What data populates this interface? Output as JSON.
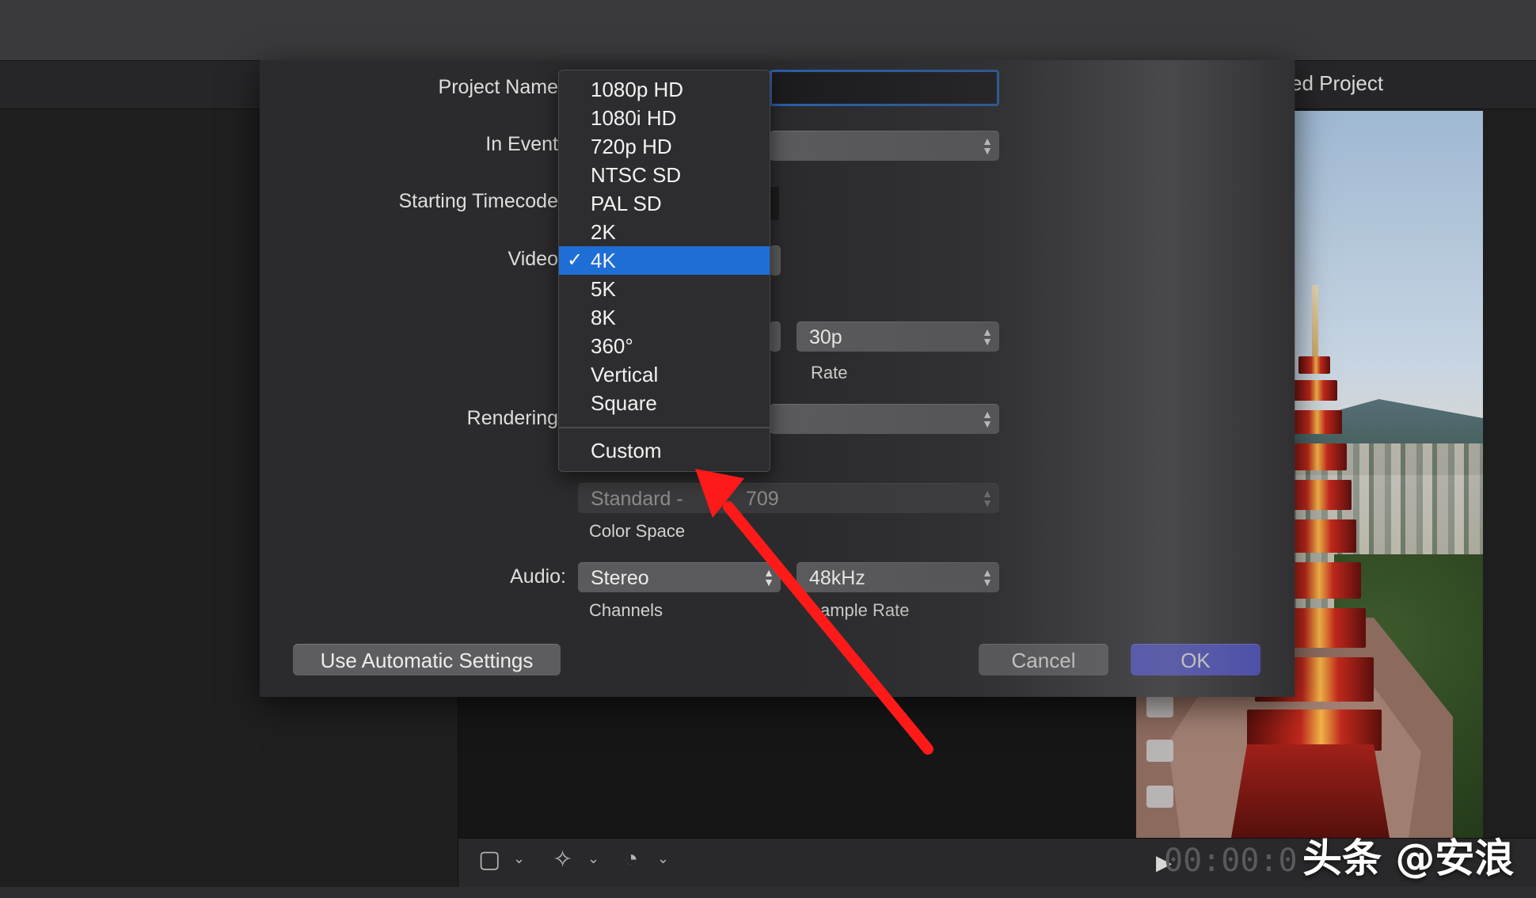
{
  "background": {
    "project_title_partial": "ed Project"
  },
  "dialog": {
    "labels": {
      "project_name": "Project Name",
      "in_event": "In Event",
      "starting_timecode": "Starting Timecode",
      "video": "Video",
      "rendering": "Rendering",
      "audio": "Audio:"
    },
    "frame_rate": {
      "value": "30p",
      "caption": "Rate"
    },
    "color_space": {
      "value": "Standard - Rec. 709",
      "value_visible": "Standard -",
      "value_tail": "709",
      "caption": "Color Space"
    },
    "audio": {
      "channels_value": "Stereo",
      "channels_caption": "Channels",
      "sample_rate_value": "48kHz",
      "sample_rate_caption_visible": "ample Rate"
    },
    "buttons": {
      "automatic": "Use Automatic Settings",
      "cancel": "Cancel",
      "ok": "OK"
    }
  },
  "format_menu": {
    "items": [
      "1080p HD",
      "1080i HD",
      "720p HD",
      "NTSC SD",
      "PAL SD",
      "2K",
      "4K",
      "5K",
      "8K",
      "360°",
      "Vertical",
      "Square"
    ],
    "selected": "4K",
    "check_glyph": "✓",
    "custom": "Custom"
  },
  "viewer": {
    "timecode_visible": "00:00:0"
  },
  "watermark": "头条 @安浪",
  "colors": {
    "accent_blue": "#1f6ed6",
    "ok_button": "#4e51d6",
    "arrow_red": "#ff1a1a"
  },
  "icons": [
    "transform-icon",
    "magic-wand-icon",
    "speed-icon",
    "chevron-down-icon",
    "play-icon",
    "stepper-icon",
    "checkmark-icon"
  ]
}
